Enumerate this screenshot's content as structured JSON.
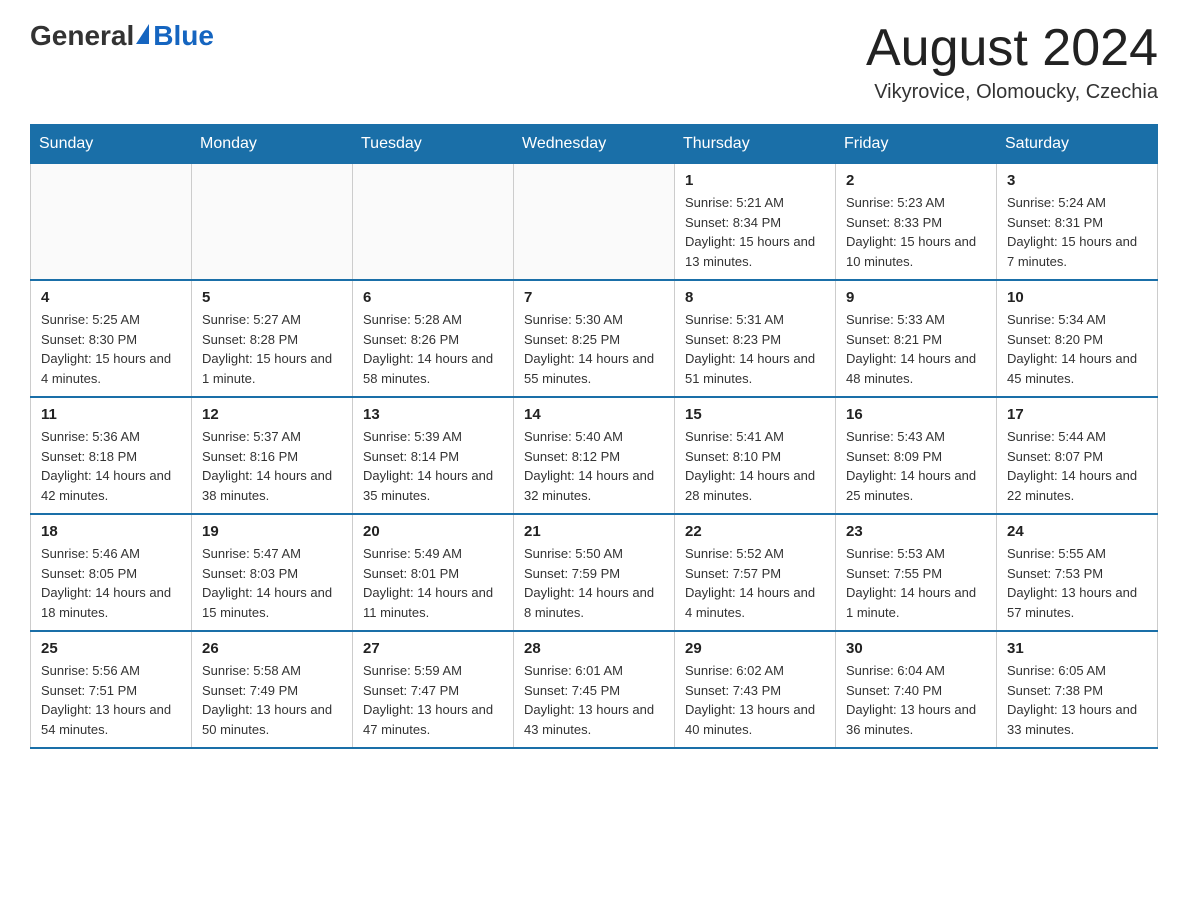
{
  "logo": {
    "general": "General",
    "blue": "Blue"
  },
  "header": {
    "month_year": "August 2024",
    "location": "Vikyrovice, Olomoucky, Czechia"
  },
  "days_of_week": [
    "Sunday",
    "Monday",
    "Tuesday",
    "Wednesday",
    "Thursday",
    "Friday",
    "Saturday"
  ],
  "weeks": [
    [
      {
        "day": "",
        "info": ""
      },
      {
        "day": "",
        "info": ""
      },
      {
        "day": "",
        "info": ""
      },
      {
        "day": "",
        "info": ""
      },
      {
        "day": "1",
        "info": "Sunrise: 5:21 AM\nSunset: 8:34 PM\nDaylight: 15 hours and 13 minutes."
      },
      {
        "day": "2",
        "info": "Sunrise: 5:23 AM\nSunset: 8:33 PM\nDaylight: 15 hours and 10 minutes."
      },
      {
        "day": "3",
        "info": "Sunrise: 5:24 AM\nSunset: 8:31 PM\nDaylight: 15 hours and 7 minutes."
      }
    ],
    [
      {
        "day": "4",
        "info": "Sunrise: 5:25 AM\nSunset: 8:30 PM\nDaylight: 15 hours and 4 minutes."
      },
      {
        "day": "5",
        "info": "Sunrise: 5:27 AM\nSunset: 8:28 PM\nDaylight: 15 hours and 1 minute."
      },
      {
        "day": "6",
        "info": "Sunrise: 5:28 AM\nSunset: 8:26 PM\nDaylight: 14 hours and 58 minutes."
      },
      {
        "day": "7",
        "info": "Sunrise: 5:30 AM\nSunset: 8:25 PM\nDaylight: 14 hours and 55 minutes."
      },
      {
        "day": "8",
        "info": "Sunrise: 5:31 AM\nSunset: 8:23 PM\nDaylight: 14 hours and 51 minutes."
      },
      {
        "day": "9",
        "info": "Sunrise: 5:33 AM\nSunset: 8:21 PM\nDaylight: 14 hours and 48 minutes."
      },
      {
        "day": "10",
        "info": "Sunrise: 5:34 AM\nSunset: 8:20 PM\nDaylight: 14 hours and 45 minutes."
      }
    ],
    [
      {
        "day": "11",
        "info": "Sunrise: 5:36 AM\nSunset: 8:18 PM\nDaylight: 14 hours and 42 minutes."
      },
      {
        "day": "12",
        "info": "Sunrise: 5:37 AM\nSunset: 8:16 PM\nDaylight: 14 hours and 38 minutes."
      },
      {
        "day": "13",
        "info": "Sunrise: 5:39 AM\nSunset: 8:14 PM\nDaylight: 14 hours and 35 minutes."
      },
      {
        "day": "14",
        "info": "Sunrise: 5:40 AM\nSunset: 8:12 PM\nDaylight: 14 hours and 32 minutes."
      },
      {
        "day": "15",
        "info": "Sunrise: 5:41 AM\nSunset: 8:10 PM\nDaylight: 14 hours and 28 minutes."
      },
      {
        "day": "16",
        "info": "Sunrise: 5:43 AM\nSunset: 8:09 PM\nDaylight: 14 hours and 25 minutes."
      },
      {
        "day": "17",
        "info": "Sunrise: 5:44 AM\nSunset: 8:07 PM\nDaylight: 14 hours and 22 minutes."
      }
    ],
    [
      {
        "day": "18",
        "info": "Sunrise: 5:46 AM\nSunset: 8:05 PM\nDaylight: 14 hours and 18 minutes."
      },
      {
        "day": "19",
        "info": "Sunrise: 5:47 AM\nSunset: 8:03 PM\nDaylight: 14 hours and 15 minutes."
      },
      {
        "day": "20",
        "info": "Sunrise: 5:49 AM\nSunset: 8:01 PM\nDaylight: 14 hours and 11 minutes."
      },
      {
        "day": "21",
        "info": "Sunrise: 5:50 AM\nSunset: 7:59 PM\nDaylight: 14 hours and 8 minutes."
      },
      {
        "day": "22",
        "info": "Sunrise: 5:52 AM\nSunset: 7:57 PM\nDaylight: 14 hours and 4 minutes."
      },
      {
        "day": "23",
        "info": "Sunrise: 5:53 AM\nSunset: 7:55 PM\nDaylight: 14 hours and 1 minute."
      },
      {
        "day": "24",
        "info": "Sunrise: 5:55 AM\nSunset: 7:53 PM\nDaylight: 13 hours and 57 minutes."
      }
    ],
    [
      {
        "day": "25",
        "info": "Sunrise: 5:56 AM\nSunset: 7:51 PM\nDaylight: 13 hours and 54 minutes."
      },
      {
        "day": "26",
        "info": "Sunrise: 5:58 AM\nSunset: 7:49 PM\nDaylight: 13 hours and 50 minutes."
      },
      {
        "day": "27",
        "info": "Sunrise: 5:59 AM\nSunset: 7:47 PM\nDaylight: 13 hours and 47 minutes."
      },
      {
        "day": "28",
        "info": "Sunrise: 6:01 AM\nSunset: 7:45 PM\nDaylight: 13 hours and 43 minutes."
      },
      {
        "day": "29",
        "info": "Sunrise: 6:02 AM\nSunset: 7:43 PM\nDaylight: 13 hours and 40 minutes."
      },
      {
        "day": "30",
        "info": "Sunrise: 6:04 AM\nSunset: 7:40 PM\nDaylight: 13 hours and 36 minutes."
      },
      {
        "day": "31",
        "info": "Sunrise: 6:05 AM\nSunset: 7:38 PM\nDaylight: 13 hours and 33 minutes."
      }
    ]
  ]
}
